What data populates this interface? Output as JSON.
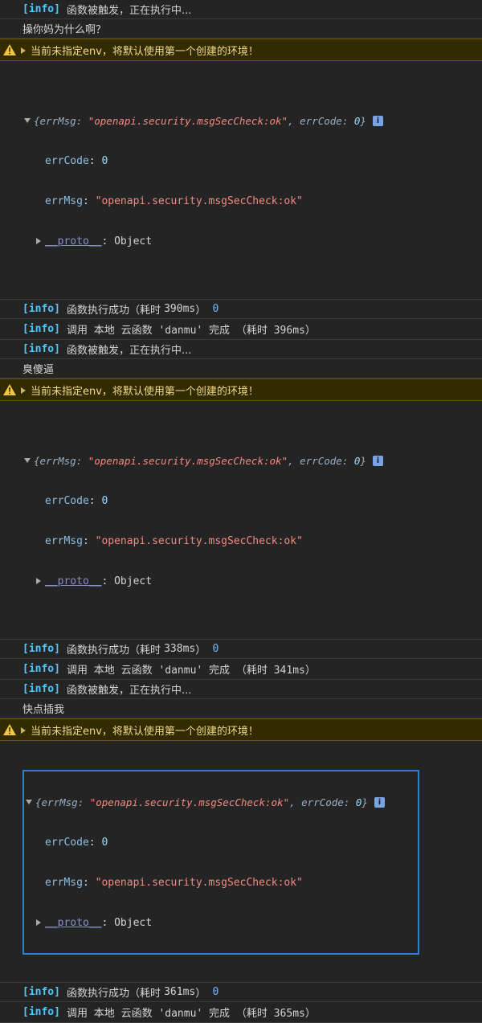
{
  "info_tag": "[info]",
  "warn_text": "当前未指定env，将默认使用第一个创建的环境！",
  "obj": {
    "head_prefix": "{errMsg: ",
    "head_msg": "\"openapi.security.msgSecCheck:ok\"",
    "head_mid": ", errCode: ",
    "head_code": "0",
    "head_suffix": "}",
    "badge": "i",
    "k_errCode": "errCode",
    "v_errCode": "0",
    "k_errMsg": "errMsg",
    "v_errMsg": "\"openapi.security.msgSecCheck:ok\"",
    "k_proto": "__proto__",
    "v_proto": "Object",
    "colon": ": "
  },
  "groups": [
    {
      "trigger": "函数被触发，正在执行中...",
      "user_text": "操你妈为什么啊？",
      "success_label": "函数执行成功（耗时 ",
      "success_ms": "390ms",
      "success_tail": "）",
      "success_code": "0",
      "call_text": "调用 本地 云函数 'danmu' 完成 （耗时 396ms）"
    },
    {
      "trigger": "函数被触发，正在执行中...",
      "user_text": "臭傻逼",
      "success_label": "函数执行成功（耗时 ",
      "success_ms": "338ms",
      "success_tail": "）",
      "success_code": "0",
      "call_text": "调用 本地 云函数 'danmu' 完成 （耗时 341ms）"
    },
    {
      "trigger": "函数被触发，正在执行中...",
      "user_text": "快点插我",
      "success_label": "函数执行成功（耗时 ",
      "success_ms": "361ms",
      "success_tail": "）",
      "success_code": "0",
      "call_text": "调用 本地 云函数 'danmu' 完成 （耗时 365ms）"
    }
  ],
  "colors": {
    "background": "#242424",
    "info": "#4ec9ff",
    "warning_bg": "#332b00",
    "warning_text": "#f0d98a",
    "string": "#f28b82",
    "selection": "#2d7fd3"
  }
}
